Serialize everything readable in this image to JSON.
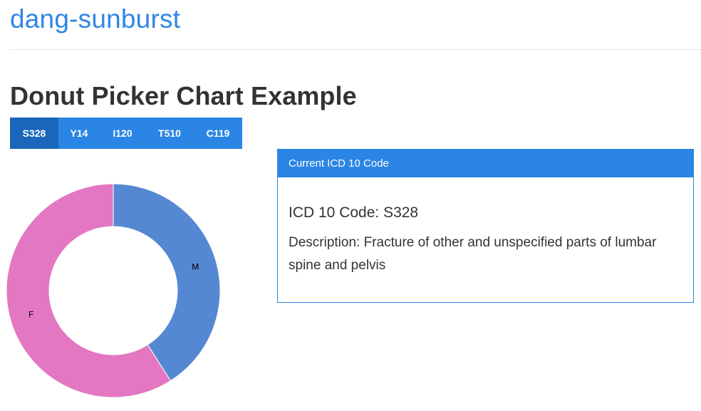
{
  "header": {
    "site_title": "dang-sunburst"
  },
  "main": {
    "title": "Donut Picker Chart Example"
  },
  "tabs": [
    {
      "label": "S328",
      "active": true
    },
    {
      "label": "Y14",
      "active": false
    },
    {
      "label": "I120",
      "active": false
    },
    {
      "label": "T510",
      "active": false
    },
    {
      "label": "C119",
      "active": false
    }
  ],
  "panel": {
    "header": "Current ICD 10 Code",
    "code_line": "ICD 10 Code: S328",
    "description_line": "Description: Fracture of other and unspecified parts of lumbar spine and pelvis"
  },
  "colors": {
    "accent": "#2b85e4",
    "tab_active": "#1a66bb",
    "title_link": "#2f86e6",
    "slice_m": "#5588d3",
    "slice_f": "#e377c2"
  },
  "chart_data": {
    "type": "pie",
    "donut": true,
    "series": [
      {
        "labels": [
          "M",
          "F"
        ],
        "values": [
          41,
          59
        ],
        "colors": [
          "#5588d3",
          "#e377c2"
        ]
      }
    ]
  }
}
